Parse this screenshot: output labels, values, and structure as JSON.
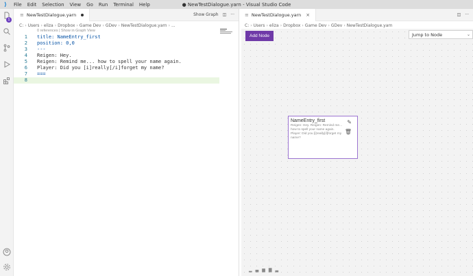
{
  "window": {
    "title": "● NewTestDialogue.yarn - Visual Studio Code",
    "menu": [
      "File",
      "Edit",
      "Selection",
      "View",
      "Go",
      "Run",
      "Terminal",
      "Help"
    ]
  },
  "activity_bar": {
    "badge": "1",
    "icons": [
      "files-icon",
      "search-icon",
      "source-control-icon",
      "run-debug-icon",
      "extensions-icon",
      "account-icon",
      "settings-gear-icon"
    ]
  },
  "left_editor": {
    "tab_label": "NewTestDialogue.yarn",
    "show_graph_label": "Show Graph",
    "breadcrumb": [
      "C:",
      "Users",
      "eliza",
      "Dropbox",
      "Game Dev",
      "GDev",
      "NewTestDialogue.yarn",
      "..."
    ],
    "codelens": "0 references | Show in Graph View",
    "lines": [
      {
        "num": "1",
        "text": "title: NameEntry_first"
      },
      {
        "num": "2",
        "text": "position: 0,0"
      },
      {
        "num": "3",
        "text": "---"
      },
      {
        "num": "4",
        "text": "Reigen: Hey."
      },
      {
        "num": "5",
        "text": "Reigen: Remind me... how to spell your name again."
      },
      {
        "num": "6",
        "text": "Player: Did you [i]really[/i]forget my name?"
      },
      {
        "num": "7",
        "text": "==="
      },
      {
        "num": "8",
        "text": ""
      }
    ]
  },
  "right_editor": {
    "tab_label": "NewTestDialogue.yarn",
    "breadcrumb": [
      "C:",
      "Users",
      "eliza",
      "Dropbox",
      "Game Dev",
      "GDev",
      "NewTestDialogue.yarn"
    ],
    "add_node_label": "Add Node",
    "jump_placeholder": "Jump to Node",
    "node": {
      "title": "NameEntry_first",
      "body": "Reigen: Hey. Reigen: Remind me... how to spell your name again. Player: Did you [i]really[/i]forget my name?"
    }
  },
  "colors": {
    "accent": "#6f3aa8",
    "node_border": "#9b73d0",
    "current_line": "#eaf6e1"
  }
}
